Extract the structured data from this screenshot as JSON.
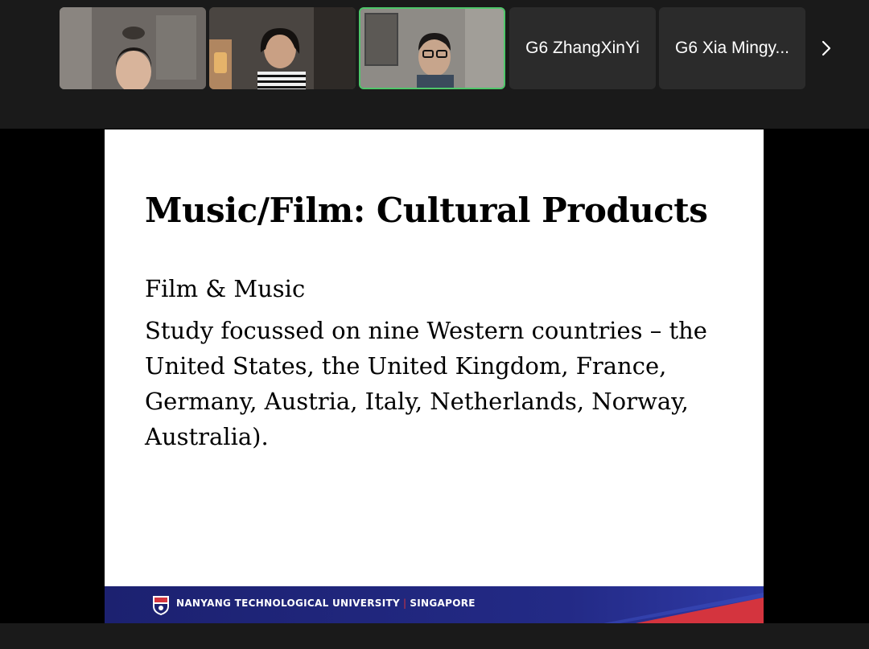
{
  "participants": [
    {
      "type": "video",
      "description_icon": "person-video"
    },
    {
      "type": "video",
      "description_icon": "person-video"
    },
    {
      "type": "video",
      "description_icon": "person-video",
      "active_speaker": true
    },
    {
      "type": "name",
      "name": "G6 ZhangXinYi"
    },
    {
      "type": "name",
      "name": "G6 Xia Mingy..."
    }
  ],
  "gallery_next_icon": "chevron-right-icon",
  "slide": {
    "title": "Music/Film: Cultural Products",
    "paragraphs": [
      "Film & Music",
      "Study focussed on nine Western countries – the United States, the United Kingdom, France, Germany, Austria, Italy, Netherlands, Norway, Australia)."
    ],
    "footer": {
      "university": "NANYANG TECHNOLOGICAL UNIVERSITY",
      "separator": "|",
      "location": "SINGAPORE"
    }
  },
  "colors": {
    "active_speaker_border": "#4fc76a",
    "footer_blue": "#1c2170",
    "footer_red": "#d4343e"
  }
}
